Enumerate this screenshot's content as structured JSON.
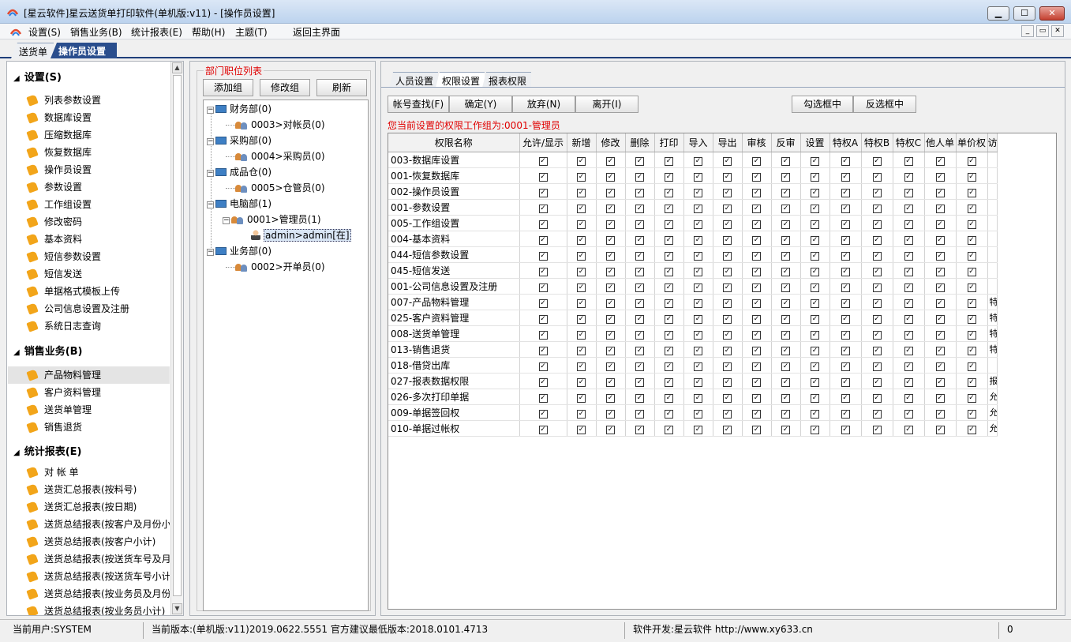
{
  "window": {
    "title": "[星云软件]星云送货单打印软件(单机版:v11) - [操作员设置]",
    "min": "▁",
    "max": "☐",
    "close": "✕"
  },
  "menu": {
    "items": [
      "设置(S)",
      "销售业务(B)",
      "统计报表(E)",
      "帮助(H)",
      "主题(T)",
      "返回主界面"
    ],
    "mdi_min": "_",
    "mdi_restore": "▭",
    "mdi_close": "✕"
  },
  "doc_tabs": [
    "送货单",
    "操作员设置"
  ],
  "left_nav": {
    "sections": [
      {
        "title": "设置(S)",
        "items": [
          "列表参数设置",
          "数据库设置",
          "压缩数据库",
          "恢复数据库",
          "操作员设置",
          "参数设置",
          "工作组设置",
          "修改密码",
          "基本资料",
          "短信参数设置",
          "短信发送",
          "单据格式模板上传",
          "公司信息设置及注册",
          "系统日志查询"
        ]
      },
      {
        "title": "销售业务(B)",
        "items": [
          "产品物料管理",
          "客户资料管理",
          "送货单管理",
          "销售退货"
        ]
      },
      {
        "title": "统计报表(E)",
        "items": [
          "对 帐 单",
          "送货汇总报表(按料号)",
          "送货汇总报表(按日期)",
          "送货总结报表(按客户及月份小",
          "送货总结报表(按客户小计)",
          "送货总结报表(按送货车号及月",
          "送货总结报表(按送货车号小计",
          "送货总结报表(按业务员及月份",
          "送货总结报表(按业务员小计)"
        ]
      }
    ],
    "selected": "产品物料管理",
    "scroll_up": "▲",
    "scroll_down": "▼"
  },
  "dept_panel": {
    "caption": "部门职位列表",
    "buttons": [
      "添加组",
      "修改组",
      "刷新"
    ],
    "tree": [
      {
        "dept": "财务部(0)",
        "roles": [
          {
            "role": "0003>对帐员(0)"
          }
        ]
      },
      {
        "dept": "采购部(0)",
        "roles": [
          {
            "role": "0004>采购员(0)"
          }
        ]
      },
      {
        "dept": "成品仓(0)",
        "roles": [
          {
            "role": "0005>仓管员(0)"
          }
        ]
      },
      {
        "dept": "电脑部(1)",
        "roles": [
          {
            "role": "0001>管理员(1)",
            "users": [
              "admin>admin[在]"
            ]
          }
        ]
      },
      {
        "dept": "业务部(0)",
        "roles": [
          {
            "role": "0002>开单员(0)"
          }
        ]
      }
    ],
    "expand_sign": "−"
  },
  "perm_panel": {
    "tabs": [
      "人员设置",
      "权限设置",
      "报表权限"
    ],
    "active_tab": "权限设置",
    "buttons_left": [
      "帐号查找(F)",
      "确定(Y)",
      "放弃(N)",
      "离开(I)"
    ],
    "buttons_right": [
      "勾选框中",
      "反选框中"
    ],
    "warning": "您当前设置的权限工作组为:0001-管理员",
    "columns": [
      "权限名称",
      "允许/显示",
      "新增",
      "修改",
      "删除",
      "打印",
      "导入",
      "导出",
      "审核",
      "反审",
      "设置",
      "特权A",
      "特权B",
      "特权C",
      "他人单",
      "单价权",
      "访"
    ],
    "check_mark": "✓",
    "rows": [
      {
        "name": "003-数据库设置",
        "extra": ""
      },
      {
        "name": "001-恢复数据库",
        "extra": ""
      },
      {
        "name": "002-操作员设置",
        "extra": ""
      },
      {
        "name": "001-参数设置",
        "extra": ""
      },
      {
        "name": "005-工作组设置",
        "extra": ""
      },
      {
        "name": "004-基本资料",
        "extra": ""
      },
      {
        "name": "044-短信参数设置",
        "extra": ""
      },
      {
        "name": "045-短信发送",
        "extra": ""
      },
      {
        "name": "001-公司信息设置及注册",
        "extra": ""
      },
      {
        "name": "007-产品物料管理",
        "extra": "特"
      },
      {
        "name": "025-客户资料管理",
        "extra": "特"
      },
      {
        "name": "008-送货单管理",
        "extra": "特"
      },
      {
        "name": "013-销售退货",
        "extra": "特"
      },
      {
        "name": "018-借贷出库",
        "extra": ""
      },
      {
        "name": "027-报表数据权限",
        "extra": "报"
      },
      {
        "name": "026-多次打印单据",
        "extra": "允"
      },
      {
        "name": "009-单据签回权",
        "extra": "允"
      },
      {
        "name": "010-单据过帐权",
        "extra": "允"
      }
    ],
    "checked_columns": 15
  },
  "status": {
    "user": "当前用户:SYSTEM",
    "version": "当前版本:(单机版:v11)2019.0622.5551 官方建议最低版本:2018.0101.4713",
    "developer": "软件开发:星云软件 http://www.xy633.cn",
    "count": "0"
  },
  "colors": {
    "accent": "#2a4e8d",
    "warning": "#e00000",
    "nav_tag": "#f2a51a"
  }
}
